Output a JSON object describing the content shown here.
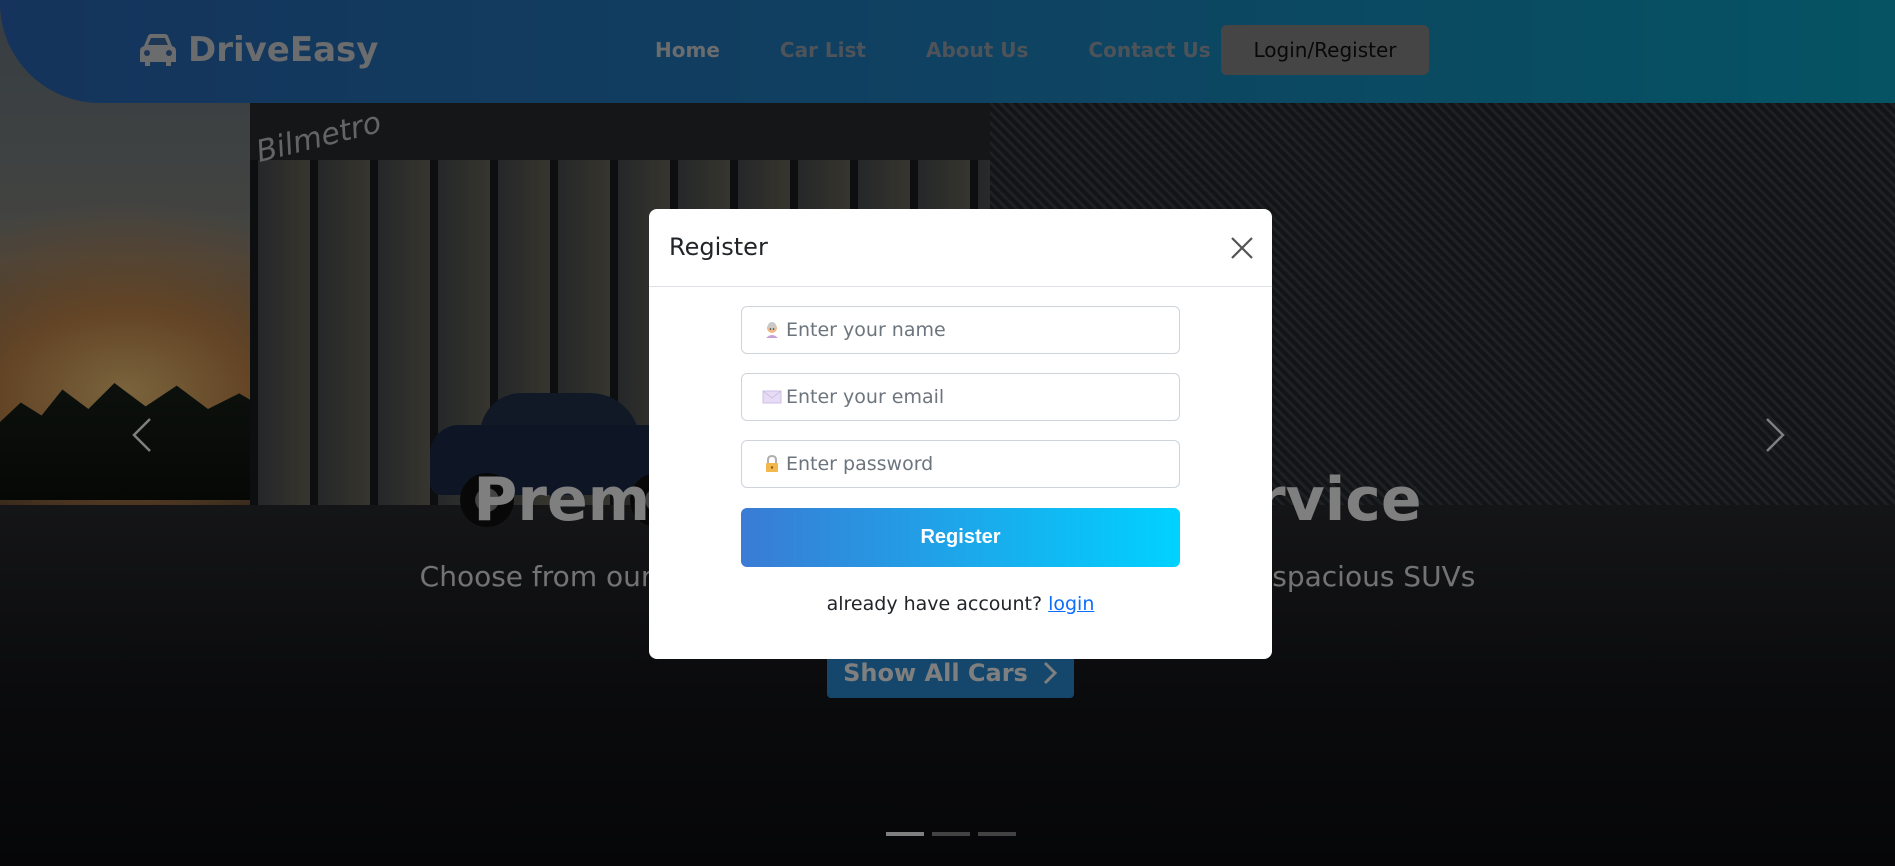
{
  "brand": {
    "name": "DriveEasy",
    "icon": "car-icon"
  },
  "nav": {
    "items": [
      {
        "label": "Home"
      },
      {
        "label": "Car List"
      },
      {
        "label": "About Us"
      },
      {
        "label": "Contact Us"
      }
    ],
    "login_register": "Login/Register"
  },
  "hero": {
    "sign": "Bilmetro",
    "title": "Premium Car Rental Service",
    "subtitle": "Choose from our collection of vehicles from compact cars to spacious SUVs",
    "button": "Show All Cars",
    "button_icon": "chevron-right-icon",
    "prev_icon": "chevron-left-icon",
    "next_icon": "chevron-right-icon",
    "slides": 3,
    "active_slide": 1
  },
  "modal": {
    "title": "Register",
    "close_icon": "close-icon",
    "name_placeholder": "Enter your name",
    "email_placeholder": "Enter your email",
    "password_placeholder": "Enter password",
    "name_icon": "person-icon",
    "email_icon": "envelope-icon",
    "password_icon": "lock-icon",
    "submit_label": "Register",
    "account_prompt": "already have account?",
    "login_link": "login"
  },
  "colors": {
    "nav_gradient_start": "#2a67b8",
    "nav_gradient_end": "#0aa7c6",
    "register_gradient_start": "#3a7bd5",
    "register_gradient_end": "#00d2ff",
    "link": "#0d6efd"
  }
}
